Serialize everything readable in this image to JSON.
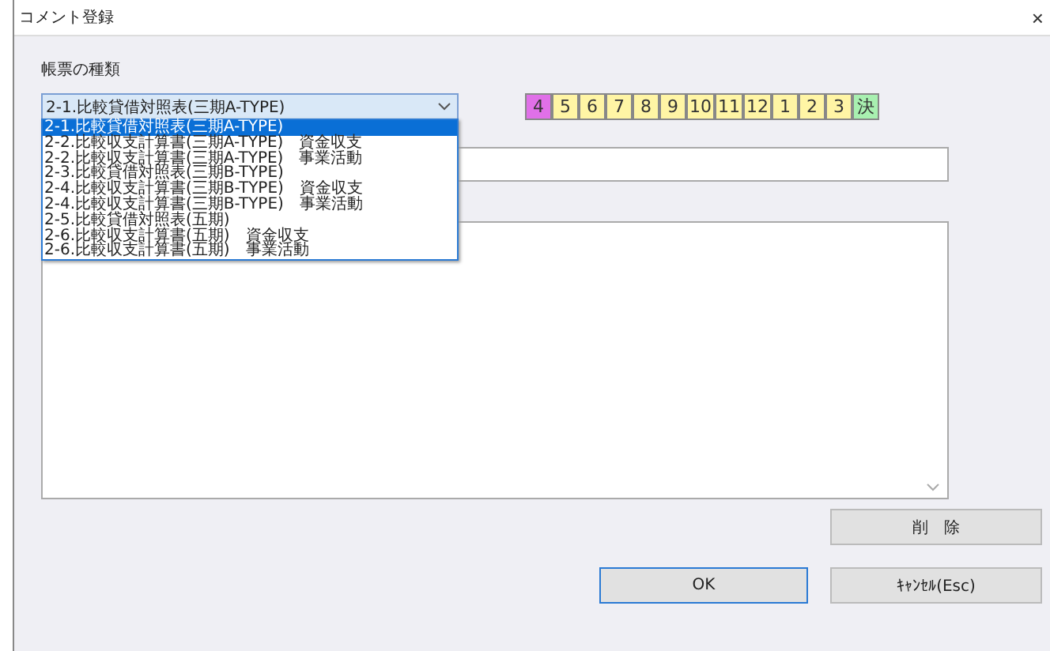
{
  "window": {
    "title": "コメント登録",
    "close": "×"
  },
  "form_type": {
    "label": "帳票の種類",
    "value": "2-1.比較貸借対照表(三期A-TYPE)",
    "expanded": true,
    "options": [
      {
        "label": "2-1.比較貸借対照表(三期A-TYPE)",
        "selected": true
      },
      {
        "label": "2-2.比較収支計算書(三期A-TYPE)　資金収支",
        "selected": false
      },
      {
        "label": "2-2.比較収支計算書(三期A-TYPE)　事業活動",
        "selected": false
      },
      {
        "label": "2-3.比較貸借対照表(三期B-TYPE)",
        "selected": false
      },
      {
        "label": "2-4.比較収支計算書(三期B-TYPE)　資金収支",
        "selected": false
      },
      {
        "label": "2-4.比較収支計算書(三期B-TYPE)　事業活動",
        "selected": false
      },
      {
        "label": "2-5.比較貸借対照表(五期)",
        "selected": false
      },
      {
        "label": "2-6.比較収支計算書(五期)　資金収支",
        "selected": false
      },
      {
        "label": "2-6.比較収支計算書(五期)　事業活動",
        "selected": false
      }
    ]
  },
  "months": [
    {
      "label": "4",
      "kind": "month",
      "selected": true
    },
    {
      "label": "5",
      "kind": "month",
      "selected": false
    },
    {
      "label": "6",
      "kind": "month",
      "selected": false
    },
    {
      "label": "7",
      "kind": "month",
      "selected": false
    },
    {
      "label": "8",
      "kind": "month",
      "selected": false
    },
    {
      "label": "9",
      "kind": "month",
      "selected": false
    },
    {
      "label": "10",
      "kind": "month",
      "selected": false
    },
    {
      "label": "11",
      "kind": "month",
      "selected": false
    },
    {
      "label": "12",
      "kind": "month",
      "selected": false
    },
    {
      "label": "1",
      "kind": "month",
      "selected": false
    },
    {
      "label": "2",
      "kind": "month",
      "selected": false
    },
    {
      "label": "3",
      "kind": "month",
      "selected": false
    },
    {
      "label": "決",
      "kind": "final",
      "selected": false
    }
  ],
  "buttons": {
    "delete": "削　除",
    "ok": "OK",
    "cancel": "ｷｬﾝｾﾙ(Esc)"
  }
}
